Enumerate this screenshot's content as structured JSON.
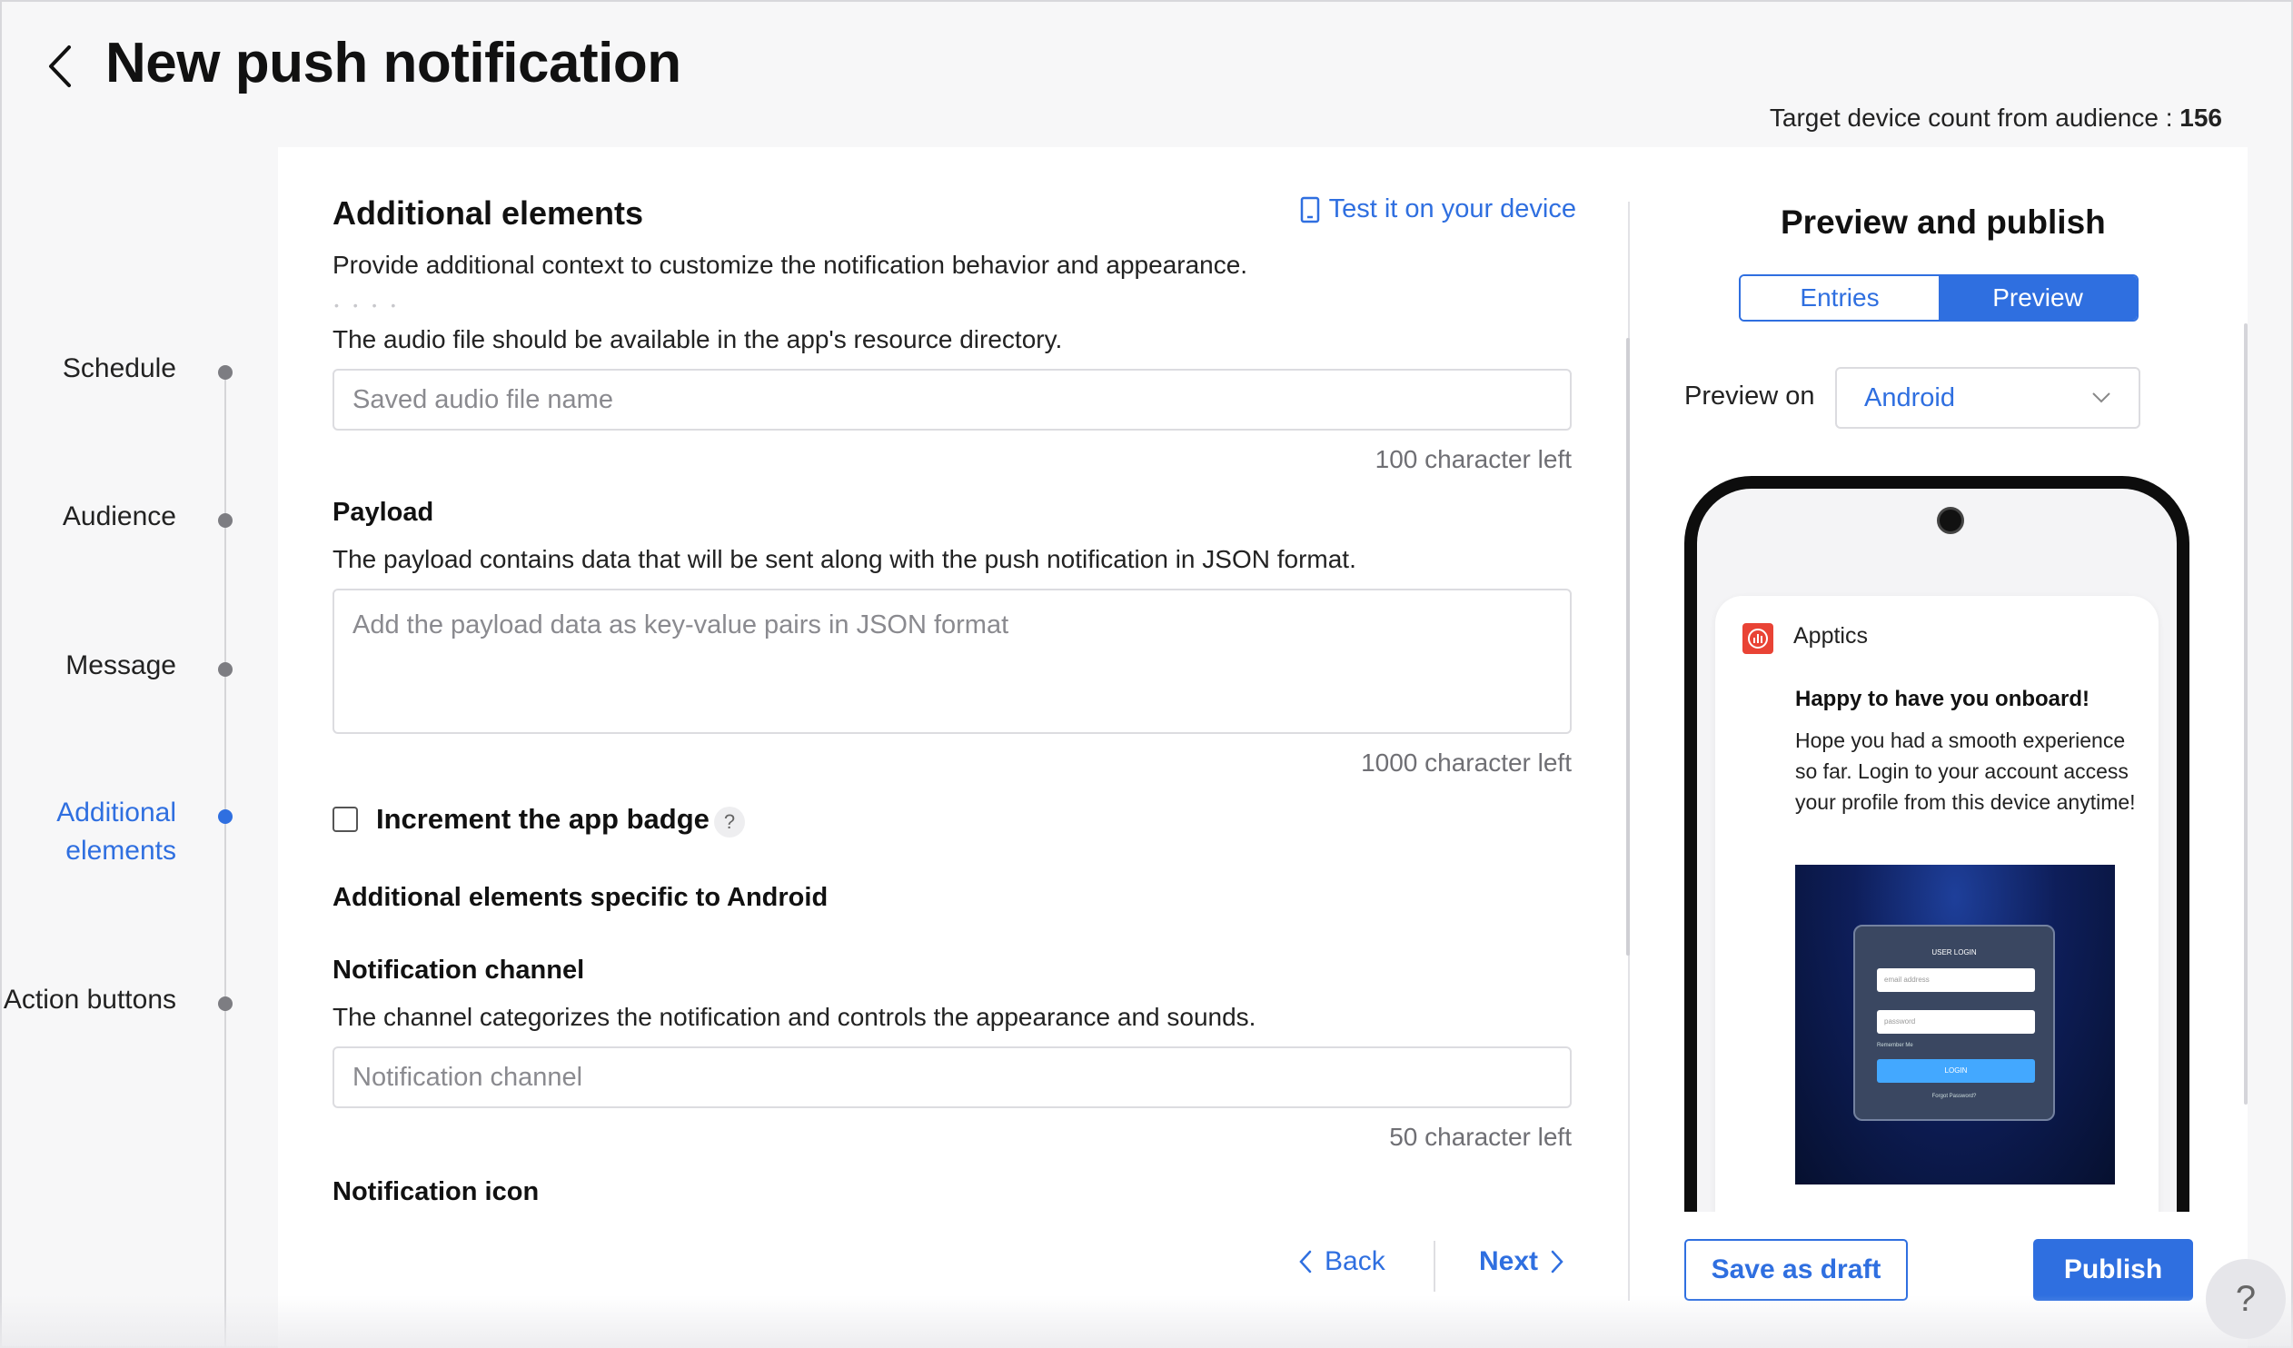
{
  "header": {
    "title": "New push notification",
    "target_label": "Target device count from audience : ",
    "target_count": "156"
  },
  "steps": [
    {
      "label": "Schedule"
    },
    {
      "label": "Audience"
    },
    {
      "label": "Message"
    },
    {
      "label": "Additional elements"
    },
    {
      "label": "Action buttons"
    }
  ],
  "main": {
    "section_title": "Additional elements",
    "test_link": "Test it on your device",
    "section_desc": "Provide additional context to customize the notification behavior and appearance.",
    "audio_desc": "The audio file should be available in the app's resource directory.",
    "audio_placeholder": "Saved audio file name",
    "audio_counter": "100 character left",
    "payload_label": "Payload",
    "payload_desc": "The payload contains data that will be sent along with the push notification in JSON format.",
    "payload_placeholder": "Add the payload data as key-value pairs in JSON format",
    "payload_counter": "1000 character left",
    "badge_label": "Increment the app badge",
    "android_heading": "Additional elements specific to Android",
    "channel_label": "Notification channel",
    "channel_desc": "The channel categorizes the notification and controls the appearance and sounds.",
    "channel_placeholder": "Notification channel",
    "channel_counter": "50 character left",
    "icon_label": "Notification icon",
    "back_label": "Back",
    "next_label": "Next"
  },
  "preview": {
    "title": "Preview and publish",
    "tabs": [
      "Entries",
      "Preview"
    ],
    "active_tab": "Preview",
    "preview_on_label": "Preview on",
    "platform": "Android",
    "notification": {
      "app_name": "Apptics",
      "title": "Happy to have you onboard!",
      "body": "Hope you had a smooth experience so far. Login to your account access your profile from this device anytime!",
      "image": {
        "title": "USER LOGIN",
        "email_placeholder": "email address",
        "password_placeholder": "password",
        "remember": "Remember Me",
        "button": "LOGIN",
        "forgot": "Forgot Password?"
      }
    },
    "save_draft": "Save as draft",
    "publish": "Publish"
  },
  "help": "?",
  "colors": {
    "accent": "#2f6fe0",
    "app_icon": "#e94335"
  }
}
